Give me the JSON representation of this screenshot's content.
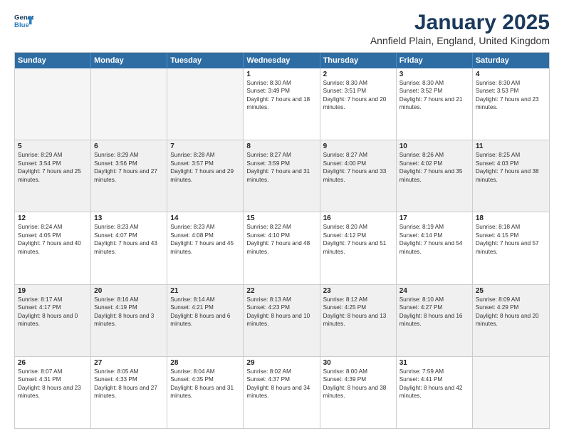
{
  "logo": {
    "line1": "General",
    "line2": "Blue"
  },
  "title": "January 2025",
  "location": "Annfield Plain, England, United Kingdom",
  "days_of_week": [
    "Sunday",
    "Monday",
    "Tuesday",
    "Wednesday",
    "Thursday",
    "Friday",
    "Saturday"
  ],
  "weeks": [
    [
      {
        "day": "",
        "empty": true
      },
      {
        "day": "",
        "empty": true
      },
      {
        "day": "",
        "empty": true
      },
      {
        "day": "1",
        "sunrise": "8:30 AM",
        "sunset": "3:49 PM",
        "daylight": "7 hours and 18 minutes."
      },
      {
        "day": "2",
        "sunrise": "8:30 AM",
        "sunset": "3:51 PM",
        "daylight": "7 hours and 20 minutes."
      },
      {
        "day": "3",
        "sunrise": "8:30 AM",
        "sunset": "3:52 PM",
        "daylight": "7 hours and 21 minutes."
      },
      {
        "day": "4",
        "sunrise": "8:30 AM",
        "sunset": "3:53 PM",
        "daylight": "7 hours and 23 minutes."
      }
    ],
    [
      {
        "day": "5",
        "sunrise": "8:29 AM",
        "sunset": "3:54 PM",
        "daylight": "7 hours and 25 minutes."
      },
      {
        "day": "6",
        "sunrise": "8:29 AM",
        "sunset": "3:56 PM",
        "daylight": "7 hours and 27 minutes."
      },
      {
        "day": "7",
        "sunrise": "8:28 AM",
        "sunset": "3:57 PM",
        "daylight": "7 hours and 29 minutes."
      },
      {
        "day": "8",
        "sunrise": "8:27 AM",
        "sunset": "3:59 PM",
        "daylight": "7 hours and 31 minutes."
      },
      {
        "day": "9",
        "sunrise": "8:27 AM",
        "sunset": "4:00 PM",
        "daylight": "7 hours and 33 minutes."
      },
      {
        "day": "10",
        "sunrise": "8:26 AM",
        "sunset": "4:02 PM",
        "daylight": "7 hours and 35 minutes."
      },
      {
        "day": "11",
        "sunrise": "8:25 AM",
        "sunset": "4:03 PM",
        "daylight": "7 hours and 38 minutes."
      }
    ],
    [
      {
        "day": "12",
        "sunrise": "8:24 AM",
        "sunset": "4:05 PM",
        "daylight": "7 hours and 40 minutes."
      },
      {
        "day": "13",
        "sunrise": "8:23 AM",
        "sunset": "4:07 PM",
        "daylight": "7 hours and 43 minutes."
      },
      {
        "day": "14",
        "sunrise": "8:23 AM",
        "sunset": "4:08 PM",
        "daylight": "7 hours and 45 minutes."
      },
      {
        "day": "15",
        "sunrise": "8:22 AM",
        "sunset": "4:10 PM",
        "daylight": "7 hours and 48 minutes."
      },
      {
        "day": "16",
        "sunrise": "8:20 AM",
        "sunset": "4:12 PM",
        "daylight": "7 hours and 51 minutes."
      },
      {
        "day": "17",
        "sunrise": "8:19 AM",
        "sunset": "4:14 PM",
        "daylight": "7 hours and 54 minutes."
      },
      {
        "day": "18",
        "sunrise": "8:18 AM",
        "sunset": "4:15 PM",
        "daylight": "7 hours and 57 minutes."
      }
    ],
    [
      {
        "day": "19",
        "sunrise": "8:17 AM",
        "sunset": "4:17 PM",
        "daylight": "8 hours and 0 minutes."
      },
      {
        "day": "20",
        "sunrise": "8:16 AM",
        "sunset": "4:19 PM",
        "daylight": "8 hours and 3 minutes."
      },
      {
        "day": "21",
        "sunrise": "8:14 AM",
        "sunset": "4:21 PM",
        "daylight": "8 hours and 6 minutes."
      },
      {
        "day": "22",
        "sunrise": "8:13 AM",
        "sunset": "4:23 PM",
        "daylight": "8 hours and 10 minutes."
      },
      {
        "day": "23",
        "sunrise": "8:12 AM",
        "sunset": "4:25 PM",
        "daylight": "8 hours and 13 minutes."
      },
      {
        "day": "24",
        "sunrise": "8:10 AM",
        "sunset": "4:27 PM",
        "daylight": "8 hours and 16 minutes."
      },
      {
        "day": "25",
        "sunrise": "8:09 AM",
        "sunset": "4:29 PM",
        "daylight": "8 hours and 20 minutes."
      }
    ],
    [
      {
        "day": "26",
        "sunrise": "8:07 AM",
        "sunset": "4:31 PM",
        "daylight": "8 hours and 23 minutes."
      },
      {
        "day": "27",
        "sunrise": "8:05 AM",
        "sunset": "4:33 PM",
        "daylight": "8 hours and 27 minutes."
      },
      {
        "day": "28",
        "sunrise": "8:04 AM",
        "sunset": "4:35 PM",
        "daylight": "8 hours and 31 minutes."
      },
      {
        "day": "29",
        "sunrise": "8:02 AM",
        "sunset": "4:37 PM",
        "daylight": "8 hours and 34 minutes."
      },
      {
        "day": "30",
        "sunrise": "8:00 AM",
        "sunset": "4:39 PM",
        "daylight": "8 hours and 38 minutes."
      },
      {
        "day": "31",
        "sunrise": "7:59 AM",
        "sunset": "4:41 PM",
        "daylight": "8 hours and 42 minutes."
      },
      {
        "day": "",
        "empty": true
      }
    ]
  ]
}
